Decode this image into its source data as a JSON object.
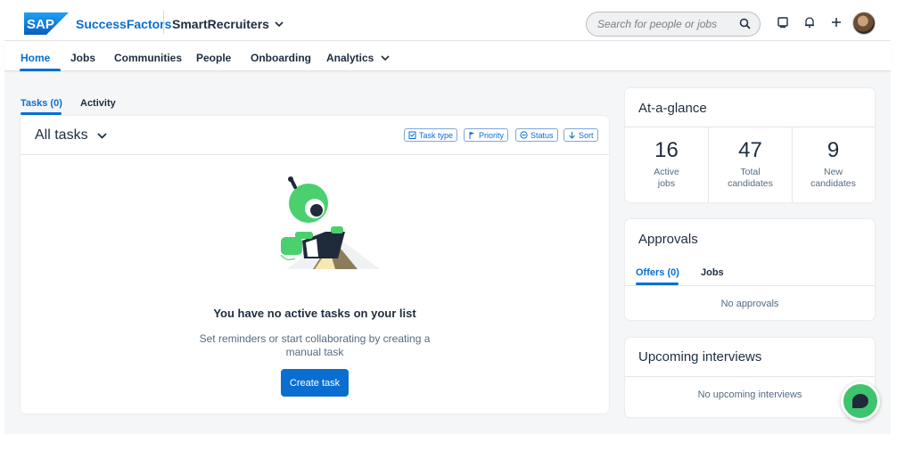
{
  "header": {
    "logo_text": "SAP",
    "brand": "SuccessFactors",
    "product": "SmartRecruiters",
    "search_placeholder": "Search for people or jobs"
  },
  "nav": {
    "items": [
      {
        "label": "Home",
        "active": true
      },
      {
        "label": "Jobs"
      },
      {
        "label": "Communities"
      },
      {
        "label": "People"
      },
      {
        "label": "Onboarding"
      },
      {
        "label": "Analytics"
      }
    ]
  },
  "tabs": {
    "tasks": "Tasks (0)",
    "activity": "Activity"
  },
  "tasks": {
    "title": "All tasks",
    "filters": [
      {
        "label": "Task type",
        "icon": "clipboard-icon"
      },
      {
        "label": "Priority",
        "icon": "flag-icon"
      },
      {
        "label": "Status",
        "icon": "status-circle-icon"
      },
      {
        "label": "Sort",
        "icon": "arrow-down-icon"
      }
    ],
    "empty_title": "You have no active tasks on your list",
    "empty_desc": "Set reminders or start collaborating by creating a manual task",
    "create_label": "Create task"
  },
  "at_a_glance": {
    "title": "At-a-glance",
    "stats": [
      {
        "value": "16",
        "label_1": "Active",
        "label_2": "jobs"
      },
      {
        "value": "47",
        "label_1": "Total",
        "label_2": "candidates"
      },
      {
        "value": "9",
        "label_1": "New",
        "label_2": "candidates"
      }
    ]
  },
  "approvals": {
    "title": "Approvals",
    "tabs": [
      "Offers (0)",
      "Jobs"
    ],
    "empty": "No approvals"
  },
  "interviews": {
    "title": "Upcoming interviews",
    "empty": "No upcoming interviews"
  },
  "colors": {
    "accent": "#0a6ed1",
    "chat": "#3ec46d"
  }
}
